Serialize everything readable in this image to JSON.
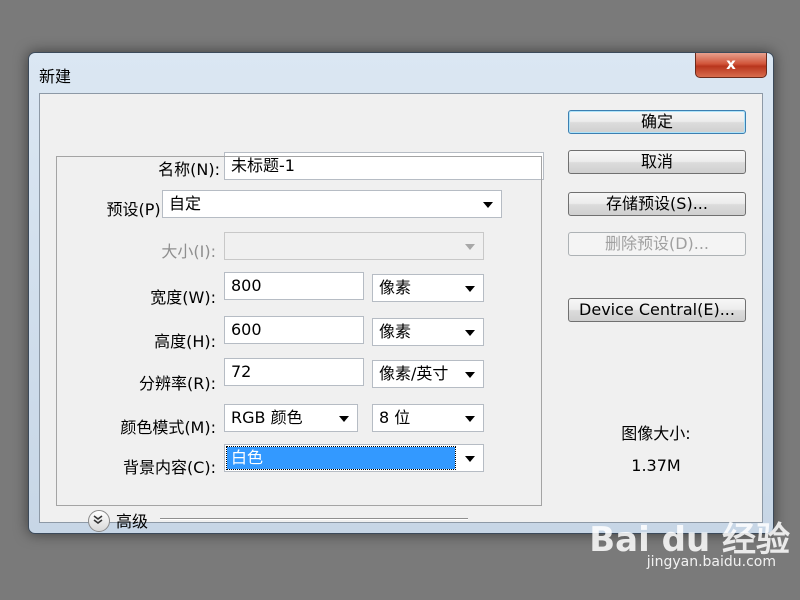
{
  "dialog": {
    "title": "新建",
    "close_label": "x"
  },
  "form": {
    "name_label": "名称(N):",
    "name_value": "未标题-1",
    "preset_label": "预设(P):",
    "preset_value": "自定",
    "size_label": "大小(I):",
    "size_value": "",
    "width_label": "宽度(W):",
    "width_value": "800",
    "width_unit": "像素",
    "height_label": "高度(H):",
    "height_value": "600",
    "height_unit": "像素",
    "resolution_label": "分辨率(R):",
    "resolution_value": "72",
    "resolution_unit": "像素/英寸",
    "color_mode_label": "颜色模式(M):",
    "color_mode_value": "RGB 颜色",
    "bit_depth_value": "8 位",
    "background_label": "背景内容(C):",
    "background_value": "白色",
    "advanced_label": "高级"
  },
  "buttons": {
    "ok": "确定",
    "cancel": "取消",
    "save_preset": "存储预设(S)...",
    "delete_preset": "删除预设(D)...",
    "device_central": "Device Central(E)..."
  },
  "info": {
    "image_size_label": "图像大小:",
    "image_size_value": "1.37M"
  },
  "watermark": {
    "logo": "Bai du 经验",
    "url": "jingyan.baidu.com"
  }
}
